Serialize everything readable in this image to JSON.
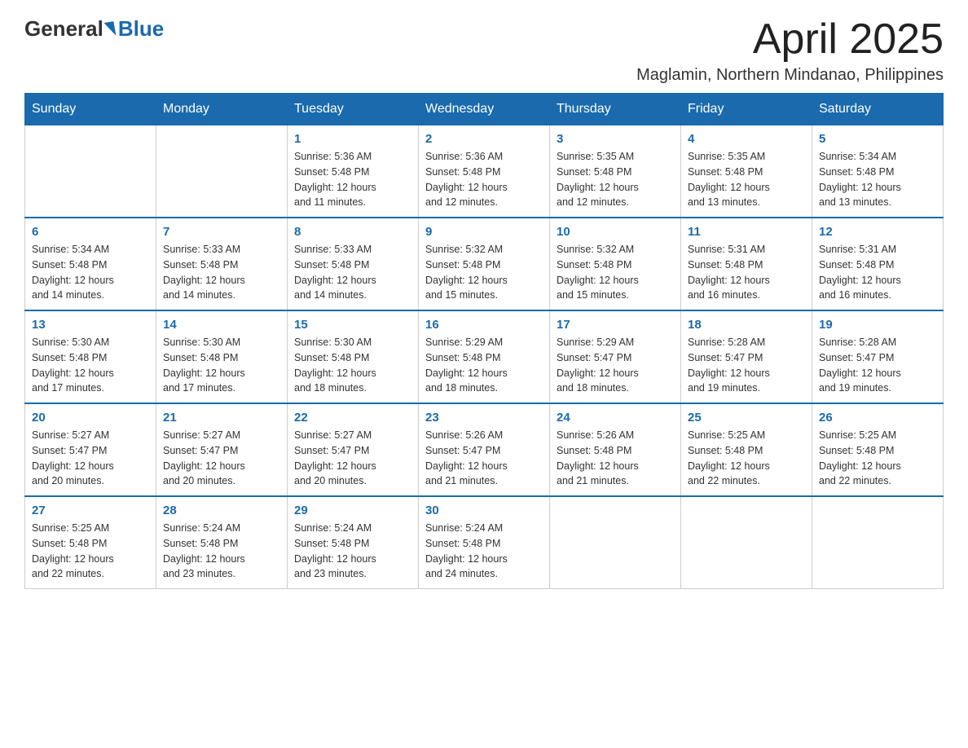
{
  "logo": {
    "general": "General",
    "blue": "Blue"
  },
  "header": {
    "title": "April 2025",
    "subtitle": "Maglamin, Northern Mindanao, Philippines"
  },
  "days_of_week": [
    "Sunday",
    "Monday",
    "Tuesday",
    "Wednesday",
    "Thursday",
    "Friday",
    "Saturday"
  ],
  "weeks": [
    [
      {
        "day": "",
        "info": ""
      },
      {
        "day": "",
        "info": ""
      },
      {
        "day": "1",
        "info": "Sunrise: 5:36 AM\nSunset: 5:48 PM\nDaylight: 12 hours\nand 11 minutes."
      },
      {
        "day": "2",
        "info": "Sunrise: 5:36 AM\nSunset: 5:48 PM\nDaylight: 12 hours\nand 12 minutes."
      },
      {
        "day": "3",
        "info": "Sunrise: 5:35 AM\nSunset: 5:48 PM\nDaylight: 12 hours\nand 12 minutes."
      },
      {
        "day": "4",
        "info": "Sunrise: 5:35 AM\nSunset: 5:48 PM\nDaylight: 12 hours\nand 13 minutes."
      },
      {
        "day": "5",
        "info": "Sunrise: 5:34 AM\nSunset: 5:48 PM\nDaylight: 12 hours\nand 13 minutes."
      }
    ],
    [
      {
        "day": "6",
        "info": "Sunrise: 5:34 AM\nSunset: 5:48 PM\nDaylight: 12 hours\nand 14 minutes."
      },
      {
        "day": "7",
        "info": "Sunrise: 5:33 AM\nSunset: 5:48 PM\nDaylight: 12 hours\nand 14 minutes."
      },
      {
        "day": "8",
        "info": "Sunrise: 5:33 AM\nSunset: 5:48 PM\nDaylight: 12 hours\nand 14 minutes."
      },
      {
        "day": "9",
        "info": "Sunrise: 5:32 AM\nSunset: 5:48 PM\nDaylight: 12 hours\nand 15 minutes."
      },
      {
        "day": "10",
        "info": "Sunrise: 5:32 AM\nSunset: 5:48 PM\nDaylight: 12 hours\nand 15 minutes."
      },
      {
        "day": "11",
        "info": "Sunrise: 5:31 AM\nSunset: 5:48 PM\nDaylight: 12 hours\nand 16 minutes."
      },
      {
        "day": "12",
        "info": "Sunrise: 5:31 AM\nSunset: 5:48 PM\nDaylight: 12 hours\nand 16 minutes."
      }
    ],
    [
      {
        "day": "13",
        "info": "Sunrise: 5:30 AM\nSunset: 5:48 PM\nDaylight: 12 hours\nand 17 minutes."
      },
      {
        "day": "14",
        "info": "Sunrise: 5:30 AM\nSunset: 5:48 PM\nDaylight: 12 hours\nand 17 minutes."
      },
      {
        "day": "15",
        "info": "Sunrise: 5:30 AM\nSunset: 5:48 PM\nDaylight: 12 hours\nand 18 minutes."
      },
      {
        "day": "16",
        "info": "Sunrise: 5:29 AM\nSunset: 5:48 PM\nDaylight: 12 hours\nand 18 minutes."
      },
      {
        "day": "17",
        "info": "Sunrise: 5:29 AM\nSunset: 5:47 PM\nDaylight: 12 hours\nand 18 minutes."
      },
      {
        "day": "18",
        "info": "Sunrise: 5:28 AM\nSunset: 5:47 PM\nDaylight: 12 hours\nand 19 minutes."
      },
      {
        "day": "19",
        "info": "Sunrise: 5:28 AM\nSunset: 5:47 PM\nDaylight: 12 hours\nand 19 minutes."
      }
    ],
    [
      {
        "day": "20",
        "info": "Sunrise: 5:27 AM\nSunset: 5:47 PM\nDaylight: 12 hours\nand 20 minutes."
      },
      {
        "day": "21",
        "info": "Sunrise: 5:27 AM\nSunset: 5:47 PM\nDaylight: 12 hours\nand 20 minutes."
      },
      {
        "day": "22",
        "info": "Sunrise: 5:27 AM\nSunset: 5:47 PM\nDaylight: 12 hours\nand 20 minutes."
      },
      {
        "day": "23",
        "info": "Sunrise: 5:26 AM\nSunset: 5:47 PM\nDaylight: 12 hours\nand 21 minutes."
      },
      {
        "day": "24",
        "info": "Sunrise: 5:26 AM\nSunset: 5:48 PM\nDaylight: 12 hours\nand 21 minutes."
      },
      {
        "day": "25",
        "info": "Sunrise: 5:25 AM\nSunset: 5:48 PM\nDaylight: 12 hours\nand 22 minutes."
      },
      {
        "day": "26",
        "info": "Sunrise: 5:25 AM\nSunset: 5:48 PM\nDaylight: 12 hours\nand 22 minutes."
      }
    ],
    [
      {
        "day": "27",
        "info": "Sunrise: 5:25 AM\nSunset: 5:48 PM\nDaylight: 12 hours\nand 22 minutes."
      },
      {
        "day": "28",
        "info": "Sunrise: 5:24 AM\nSunset: 5:48 PM\nDaylight: 12 hours\nand 23 minutes."
      },
      {
        "day": "29",
        "info": "Sunrise: 5:24 AM\nSunset: 5:48 PM\nDaylight: 12 hours\nand 23 minutes."
      },
      {
        "day": "30",
        "info": "Sunrise: 5:24 AM\nSunset: 5:48 PM\nDaylight: 12 hours\nand 24 minutes."
      },
      {
        "day": "",
        "info": ""
      },
      {
        "day": "",
        "info": ""
      },
      {
        "day": "",
        "info": ""
      }
    ]
  ]
}
